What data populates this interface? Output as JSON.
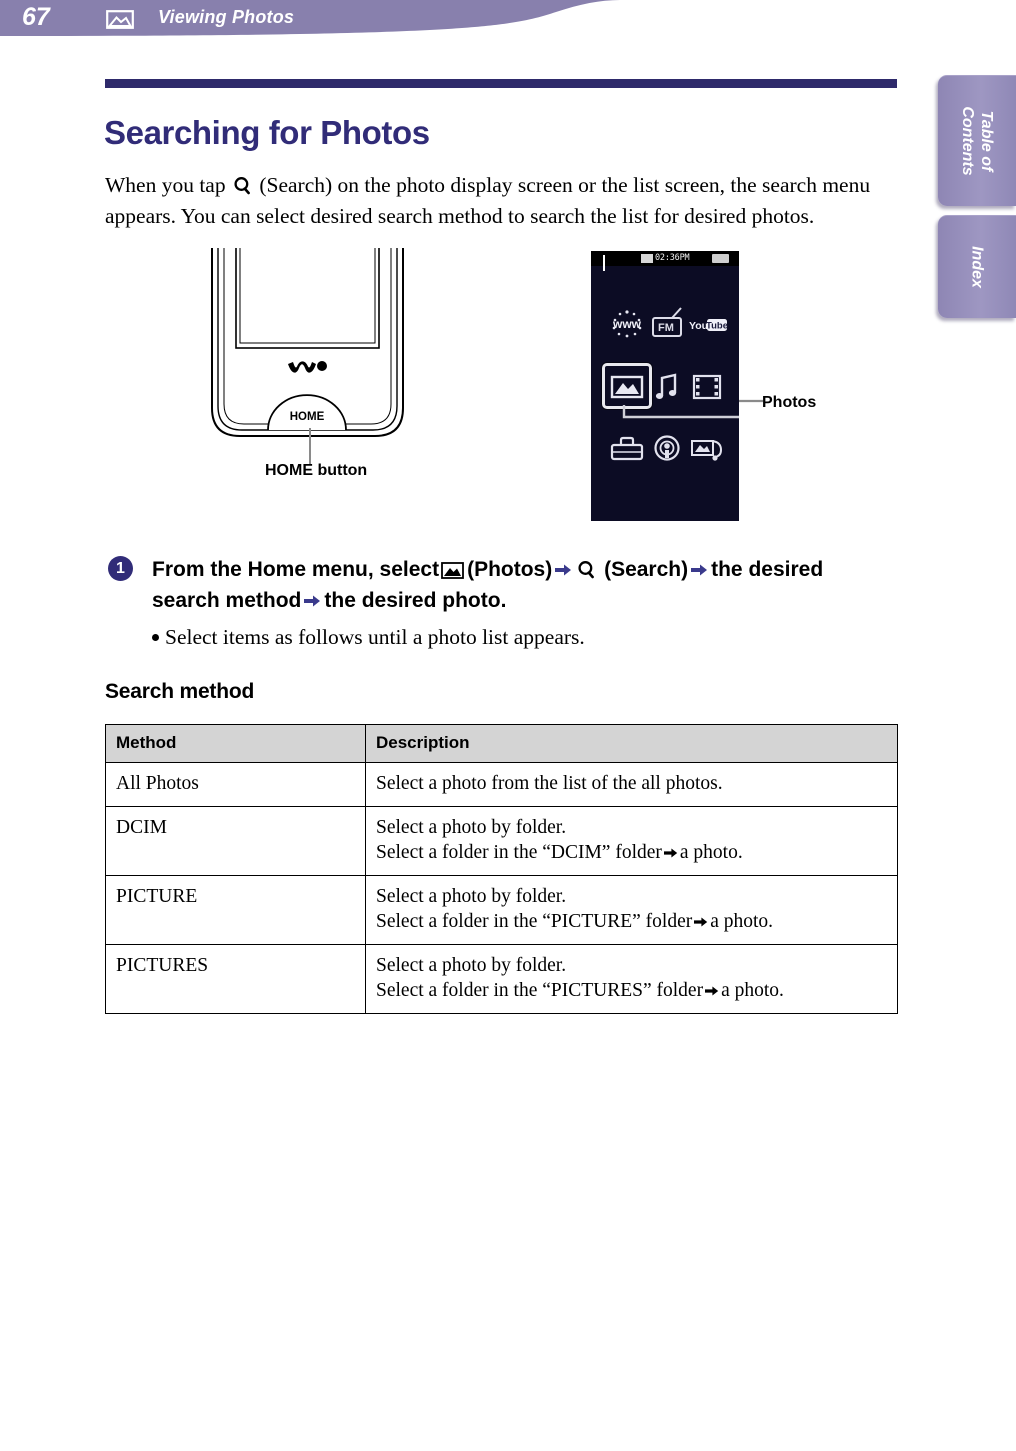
{
  "header": {
    "page_number": "67",
    "icon": "photo-icon",
    "title": "Viewing Photos",
    "bar_color": "#8880ad"
  },
  "side_tabs": [
    {
      "label": "Table of\nContents",
      "name": "table-of-contents-tab"
    },
    {
      "label": "Index",
      "name": "index-tab"
    }
  ],
  "page": {
    "title": "Searching for Photos",
    "title_color": "#312c78",
    "intro_before_icon": "When you tap ",
    "intro_after_icon": " (Search) on the photo display screen or the list screen, the search menu appears. You can select desired search method to search the list for desired photos."
  },
  "figures": {
    "device": {
      "walkman_logo": "WALKMAN",
      "home_button_text": "HOME",
      "callout_label": "HOME button"
    },
    "screen": {
      "status_bar": {
        "pause_icon": "pause-icon",
        "mute_icon": "mute-icon",
        "time": "02:36PM",
        "battery_icon": "battery-icon"
      },
      "icons": [
        {
          "name": "internet-browser-icon",
          "label": "www"
        },
        {
          "name": "fm-radio-icon",
          "label": "FM"
        },
        {
          "name": "youtube-icon",
          "label": "YouTube"
        },
        {
          "name": "photos-icon",
          "label": "Photos",
          "selected": true
        },
        {
          "name": "music-icon",
          "label": "Music"
        },
        {
          "name": "videos-icon",
          "label": "Videos"
        },
        {
          "name": "settings-icon",
          "label": "Settings"
        },
        {
          "name": "podcast-icon",
          "label": "Podcast"
        },
        {
          "name": "shop-icon",
          "label": "Shop"
        }
      ],
      "callout_label": "Photos"
    }
  },
  "step": {
    "number": "1",
    "line_part1": "From the Home menu, select",
    "photos_label": "(Photos)",
    "search_label": "(Search)",
    "line_part2": "the",
    "line_part3": "desired search method",
    "line_part4": "the desired photo.",
    "note": "Select items as follows until a photo list appears."
  },
  "table": {
    "caption": "Search method",
    "columns": [
      "Method",
      "Description"
    ],
    "rows": [
      {
        "method": "All Photos",
        "desc_line1": "Select a photo from the list of the all photos.",
        "desc_line2_before": "",
        "desc_line2_after": ""
      },
      {
        "method": "DCIM",
        "desc_line1": "Select a photo by folder.",
        "desc_line2_before": "Select a folder in the “DCIM” folder",
        "desc_line2_after": "a photo."
      },
      {
        "method": "PICTURE",
        "desc_line1": "Select a photo by folder.",
        "desc_line2_before": "Select a folder in the “PICTURE” folder",
        "desc_line2_after": "a photo."
      },
      {
        "method": "PICTURES",
        "desc_line1": "Select a photo by folder.",
        "desc_line2_before": "Select a folder in the “PICTURES” folder",
        "desc_line2_after": "a photo."
      }
    ]
  }
}
